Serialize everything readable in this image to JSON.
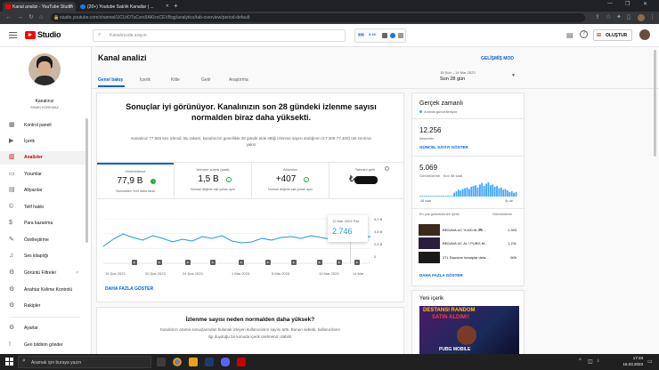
{
  "browser": {
    "tabs": [
      {
        "label": "Kanal analizi - YouTube Studio",
        "color": "#ff0000"
      },
      {
        "label": "(20+) Youtube Satılık Kanallar | ...",
        "color": "#1877f2"
      }
    ],
    "url": "studio.youtube.com/channel/UCUrDTuCsrx5AKIcsCEVBqg/analytics/tab-overview/period-default"
  },
  "header": {
    "logo_text": "Studio",
    "search_placeholder": "Kanalınızda arayın",
    "create_label": "OLUŞTUR",
    "notif_value": "5.1K"
  },
  "sidebar": {
    "channel_name": "Kanalınız",
    "channel_handle": "SINAN KORKMAZ",
    "items": [
      {
        "label": "Kontrol paneli",
        "icon": "dashboard-icon"
      },
      {
        "label": "İçerik",
        "icon": "content-icon"
      },
      {
        "label": "Analizler",
        "icon": "analytics-icon"
      },
      {
        "label": "Yorumlar",
        "icon": "comments-icon"
      },
      {
        "label": "Altyazılar",
        "icon": "subtitles-icon"
      },
      {
        "label": "Telif hakkı",
        "icon": "copyright-icon"
      },
      {
        "label": "Para kazanma",
        "icon": "monetization-icon"
      },
      {
        "label": "Özelleştirme",
        "icon": "customization-icon"
      },
      {
        "label": "Ses kitaplığı",
        "icon": "audio-library-icon"
      },
      {
        "label": "Görüntü Filtreler",
        "icon": "filter-icon"
      },
      {
        "label": "Anahtar Kelime Kontrolü",
        "icon": "keyword-icon"
      },
      {
        "label": "Rakipler",
        "icon": "competitors-icon"
      },
      {
        "label": "Ayarlar",
        "icon": "settings-icon"
      },
      {
        "label": "Geri bildirim gönder",
        "icon": "feedback-icon"
      }
    ]
  },
  "main": {
    "title": "Kanal analizi",
    "advanced_mode": "GELİŞMİŞ MOD",
    "tabs": [
      "Genel bakış",
      "İçerik",
      "Kitle",
      "Gelir",
      "Araştırma"
    ],
    "date_range": "15 Şub – 14 Mar 2023",
    "period": "Son 28 gün",
    "headline": "Sonuçlar iyi görünüyor. Kanalınızın son 28 gündeki izlenme sayısı normalden biraz daha yüksekti.",
    "description": "Kanalınız 77.949 kez izlendi. Bu rakam, kanalınızın genellikle 28 günde elde ettiği izlenme sayısı aralığının (17.300-77.400) üst sınırına yakın",
    "stats": [
      {
        "label": "Görüntüleme",
        "value": "77,9 B",
        "badge": "up",
        "sub": "Normalden %49 daha fazla"
      },
      {
        "label": "İzlenme süresi (saat)",
        "value": "1,5 B",
        "badge": "check",
        "sub": "Normal değerle eşit yukarı aynı"
      },
      {
        "label": "Aboneler",
        "value": "+407",
        "badge": "check",
        "sub": "Normal değerle eşit yukarı aynı"
      },
      {
        "label": "Tahmini gelir",
        "value": "₺",
        "badge": "",
        "sub": ""
      }
    ],
    "tooltip_date": "12 Mar 2023 Paz",
    "tooltip_value": "2.746",
    "y_ticks": [
      "5,0 B",
      "3,8 B",
      "2,5 B",
      "0"
    ],
    "x_ticks": [
      "15 Şub 2023",
      "20 Şub 2023",
      "24 Şub 2023",
      "1 Mar 2023",
      "5 Mar 2023",
      "10 Mar 2023",
      "14 Mar ..."
    ],
    "more_link": "DAHA FAZLA GÖSTER",
    "why_title": "İzlenme sayısı neden normalden daha yüksek?",
    "why_text_1": "Kanalınızı arama sonuçlarından bulanak izleyen kullanıcıların sayısı arttı. Bunun sebebi, kullanıcıların",
    "why_text_2": "ilgi duyduğu bir konuda içerik üretmeniz olabilir."
  },
  "chart_data": {
    "type": "line",
    "title": "",
    "xlabel": "",
    "ylabel": "",
    "x": [
      "15 Şub",
      "16 Şub",
      "17 Şub",
      "18 Şub",
      "19 Şub",
      "20 Şub",
      "21 Şub",
      "22 Şub",
      "23 Şub",
      "24 Şub",
      "25 Şub",
      "26 Şub",
      "27 Şub",
      "28 Şub",
      "1 Mar",
      "2 Mar",
      "3 Mar",
      "4 Mar",
      "5 Mar",
      "6 Mar",
      "7 Mar",
      "8 Mar",
      "9 Mar",
      "10 Mar",
      "11 Mar",
      "12 Mar",
      "13 Mar",
      "14 Mar"
    ],
    "series": [
      {
        "values": [
          1900,
          2700,
          3300,
          2900,
          2600,
          3100,
          2800,
          2400,
          2700,
          2500,
          3000,
          2800,
          3100,
          2500,
          2300,
          2400,
          2800,
          2600,
          2900,
          3000,
          2800,
          3100,
          2900,
          2700,
          2800,
          2746,
          2900,
          3000
        ]
      }
    ],
    "ylim": [
      0,
      5000
    ],
    "y_ticks": [
      "5,0 B",
      "3,8 B",
      "2,5 B",
      "0"
    ],
    "highlight": {
      "x": "12 Mar",
      "value": 2746
    },
    "grid": true,
    "color": "#1a9bd7"
  },
  "realtime": {
    "title": "Gerçek zamanlı",
    "subtitle": "Anında güncelleniyor",
    "subs_value": "12.256",
    "subs_label": "Aboneler",
    "subs_link": "GÜNCEL SAYIYI GÖSTER",
    "views_value": "5.069",
    "views_label": "Görüntüleme · Son 48 saat",
    "axis_left": "-48 saat",
    "axis_right": "Şu an",
    "top_label": "En çok görüntülenen içerik",
    "top_right_label": "Görüntüleme",
    "top_items": [
      {
        "title": "BEDAVA UC %100 AL 🎮...",
        "views": "1.393"
      },
      {
        "title": "BEDAVA UC AL ! PUBG M...",
        "views": "1.211"
      },
      {
        "title": "2TL Random hesaplar deta...",
        "views": "609"
      }
    ],
    "more_link": "DAHA FAZLA GÖSTER",
    "bars": [
      0.05,
      0.05,
      0.05,
      0.05,
      0.05,
      0.05,
      0.05,
      0.05,
      0.05,
      0.05,
      0.05,
      0.05,
      0.05,
      0.05,
      0.05,
      0.05,
      0.25,
      0.35,
      0.45,
      0.4,
      0.5,
      0.55,
      0.6,
      0.5,
      0.65,
      0.7,
      0.75,
      0.6,
      0.8,
      0.9,
      0.7,
      0.85,
      0.95,
      0.75,
      0.8,
      0.65,
      0.7,
      0.55,
      0.6,
      0.45,
      0.5,
      0.4,
      0.3,
      0.35,
      0.25,
      0.3
    ]
  },
  "latest": {
    "title": "Yeni içerik",
    "thumb_top": "DESTANSI RANDOM",
    "thumb_mid": "SATIN ALDIM!!",
    "thumb_bot": "PUBG MOBILE"
  },
  "taskbar": {
    "search_placeholder": "Aramak için buraya yazın",
    "time": "17:33",
    "date": "16.03.2023"
  }
}
